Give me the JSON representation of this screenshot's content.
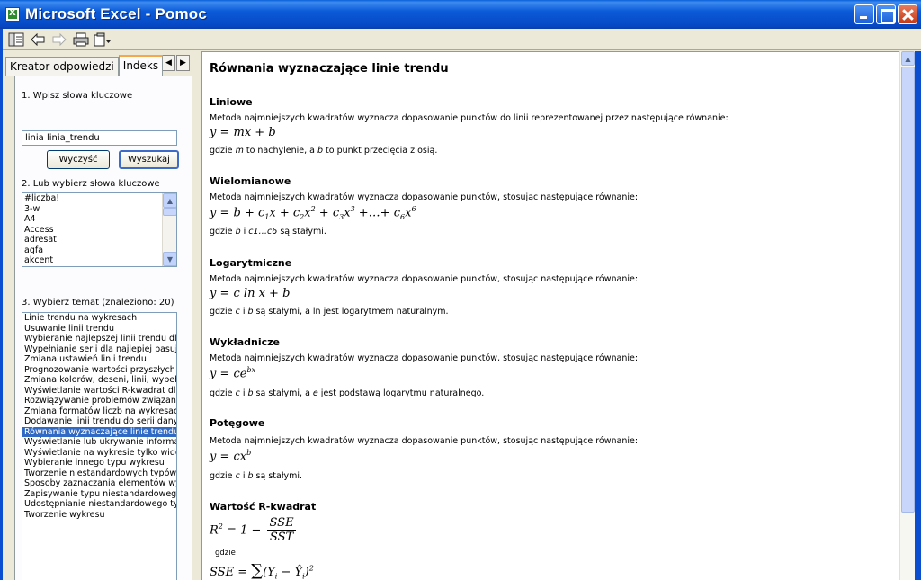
{
  "window": {
    "title": "Microsoft Excel - Pomoc"
  },
  "toolbar": {
    "icons": [
      "show-hide-icon",
      "back-icon",
      "forward-icon",
      "print-icon",
      "options-icon"
    ]
  },
  "tabs": [
    {
      "label": "Kreator odpowiedzi",
      "active": false
    },
    {
      "label": "Indeks",
      "active": true
    }
  ],
  "index": {
    "step1_label": "1. Wpisz słowa kluczowe",
    "keyword_value": "linia linia_trendu",
    "clear_button": "Wyczyść",
    "search_button": "Wyszukaj",
    "step2_label": "2. Lub wybierz słowa kluczowe",
    "keywords": [
      "#liczba!",
      "3-w",
      "A4",
      "Access",
      "adresat",
      "agfa",
      "akcent"
    ],
    "step3_label": "3. Wybierz temat (znaleziono: 20)",
    "topics": [
      "Linie trendu na wykresach",
      "Usuwanie linii trendu",
      "Wybieranie najlepszej linii trendu dla dan",
      "Wypełnianie serii dla najlepiej pasującego",
      "Zmiana ustawień linii trendu",
      "Prognozowanie wartości przyszłych i prz",
      "Zmiana kolorów, deseni, linii, wypełnień",
      "Wyświetlanie wartości R-kwadrat dla linii",
      "Rozwiązywanie problemów związanych z",
      "Zmiana formatów liczb na wykresach",
      "Dodawanie linii trendu do serii danych",
      "Równania wyznaczające linie trendu",
      "Wyświetlanie lub ukrywanie informacji na",
      "Wyświetlanie na wykresie tylko widoczny",
      "Wybieranie innego typu wykresu",
      "Tworzenie niestandardowych typów wyk",
      "Sposoby zaznaczania elementów wykres",
      "Zapisywanie typu niestandardowego do",
      "Udostępnianie niestandardowego typu w",
      "Tworzenie wykresu"
    ],
    "selected_topic_index": 11
  },
  "article": {
    "title": "Równania wyznaczające linie trendu",
    "sections": {
      "linear": {
        "title": "Liniowe",
        "desc": "Metoda najmniejszych kwadratów wyznacza dopasowanie punktów do linii reprezentowanej przez następujące równanie:",
        "note_pre": "gdzie ",
        "note_m": "m",
        "note_mid": " to nachylenie, a ",
        "note_b": "b",
        "note_post": " to punkt przecięcia z osią."
      },
      "poly": {
        "title": "Wielomianowe",
        "desc": "Metoda najmniejszych kwadratów wyznacza dopasowanie punktów, stosując następujące równanie:",
        "note_pre": "gdzie ",
        "note_b": "b",
        "note_mid": " i ",
        "note_c": "c1…c6",
        "note_post": " są stałymi."
      },
      "log": {
        "title": "Logarytmiczne",
        "desc": "Metoda najmniejszych kwadratów wyznacza dopasowanie punktów, stosując następujące równanie:",
        "note_pre": "gdzie ",
        "note_c": "c",
        "note_mid": " i ",
        "note_b": "b",
        "note_post": " są stałymi, a ln jest logarytmem naturalnym."
      },
      "exp": {
        "title": "Wykładnicze",
        "desc": "Metoda najmniejszych kwadratów wyznacza dopasowanie punktów, stosując następujące równanie:",
        "note_pre": "gdzie ",
        "note_c": "c",
        "note_mid": " i ",
        "note_b": "b",
        "note_mid2": " są stałymi, a ",
        "note_e": "e",
        "note_post": " jest podstawą logarytmu naturalnego."
      },
      "power": {
        "title": "Potęgowe",
        "desc": "Metoda najmniejszych kwadratów wyznacza dopasowanie punktów, stosując następujące równanie:",
        "note_pre": "gdzie ",
        "note_c": "c",
        "note_mid": " i ",
        "note_b": "b",
        "note_post": " są stałymi."
      },
      "r2": {
        "title": "Wartość R-kwadrat",
        "where": "gdzie"
      }
    }
  }
}
